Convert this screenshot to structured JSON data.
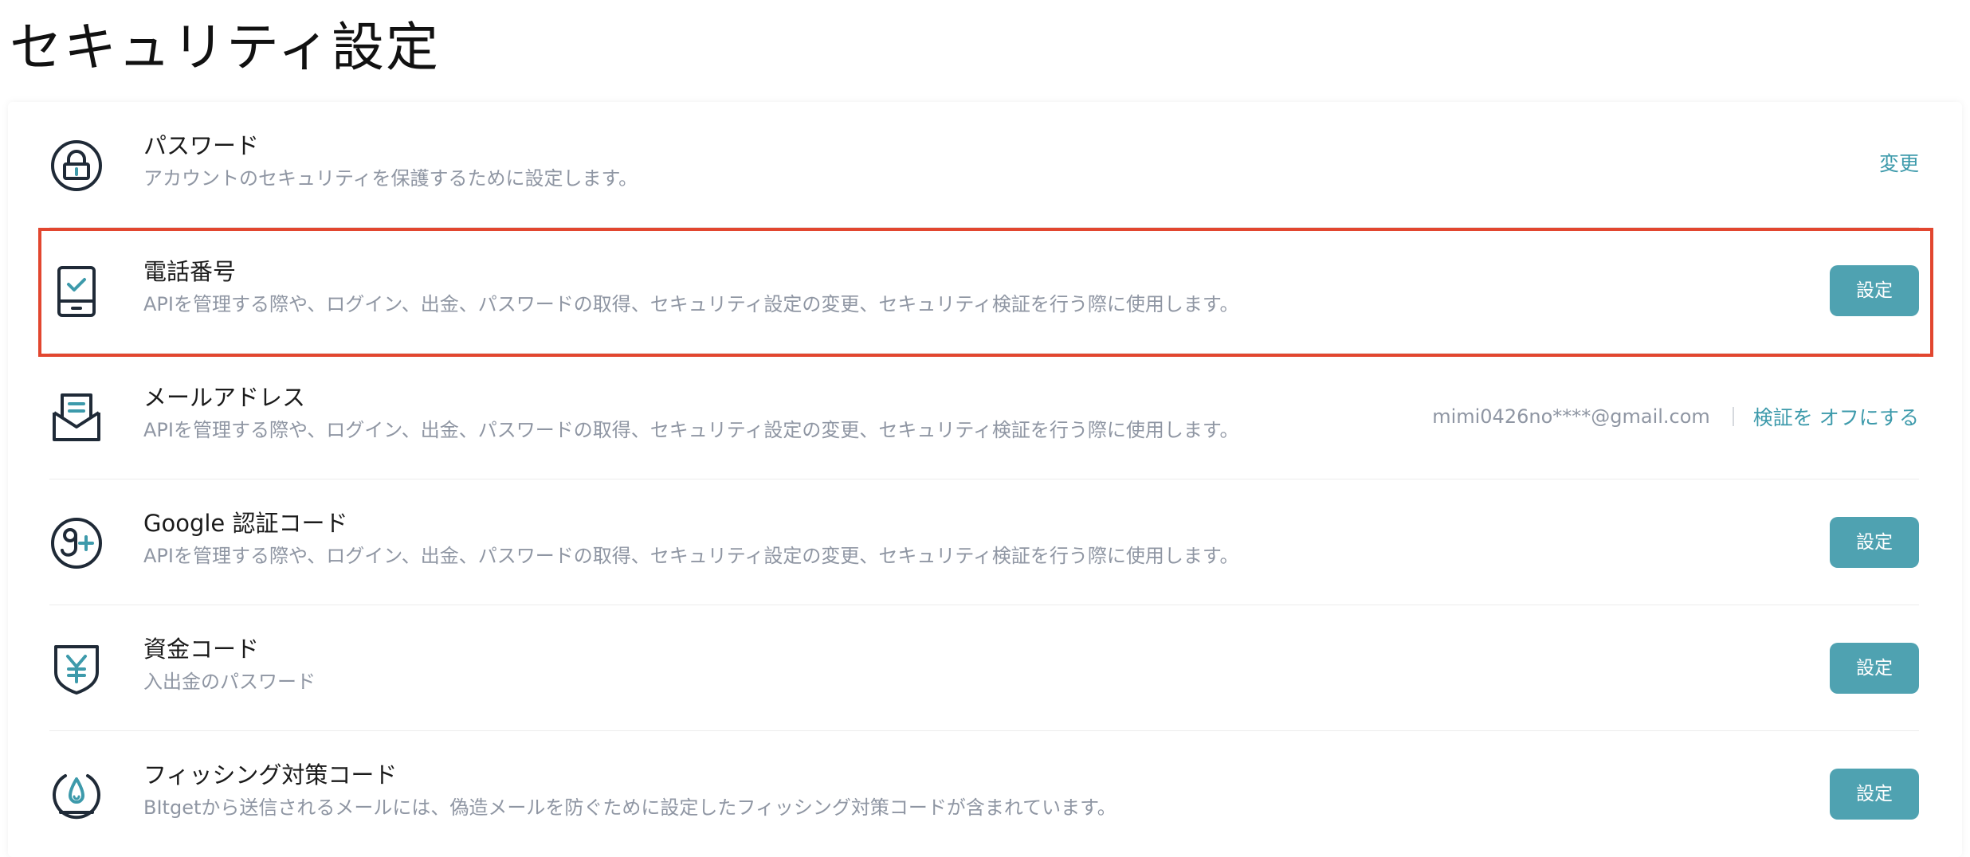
{
  "page": {
    "title": "セキュリティ設定"
  },
  "colors": {
    "accent": "#3d9aab",
    "button_bg": "#4fa2b1",
    "muted_text": "#8f96a3",
    "highlight": "#e2462f"
  },
  "rows": [
    {
      "id": "password",
      "icon": "lock-icon",
      "title": "パスワード",
      "description": "アカウントのセキュリティを保護するために設定します。",
      "action_label": "変更"
    },
    {
      "id": "phone",
      "icon": "phone-check-icon",
      "title": "電話番号",
      "description": "APIを管理する際や、ログイン、出金、パスワードの取得、セキュリティ設定の変更、セキュリティ検証を行う際に使用します。",
      "action_label": "設定"
    },
    {
      "id": "email",
      "icon": "mail-icon",
      "title": "メールアドレス",
      "description": "APIを管理する際や、ログイン、出金、パスワードの取得、セキュリティ設定の変更、セキュリティ検証を行う際に使用します。",
      "value": "mimi0426no****@gmail.com",
      "action_label": "検証を オフにする"
    },
    {
      "id": "google",
      "icon": "google-auth-icon",
      "title": "Google 認証コード",
      "description": "APIを管理する際や、ログイン、出金、パスワードの取得、セキュリティ設定の変更、セキュリティ検証を行う際に使用します。",
      "action_label": "設定"
    },
    {
      "id": "fund",
      "icon": "yen-shield-icon",
      "title": "資金コード",
      "description": "入出金のパスワード",
      "action_label": "設定"
    },
    {
      "id": "anti-phishing",
      "icon": "anti-phishing-icon",
      "title": "フィッシング対策コード",
      "description": "BItgetから送信されるメールには、偽造メールを防ぐために設定したフィッシング対策コードが含まれています。",
      "action_label": "設定"
    }
  ]
}
